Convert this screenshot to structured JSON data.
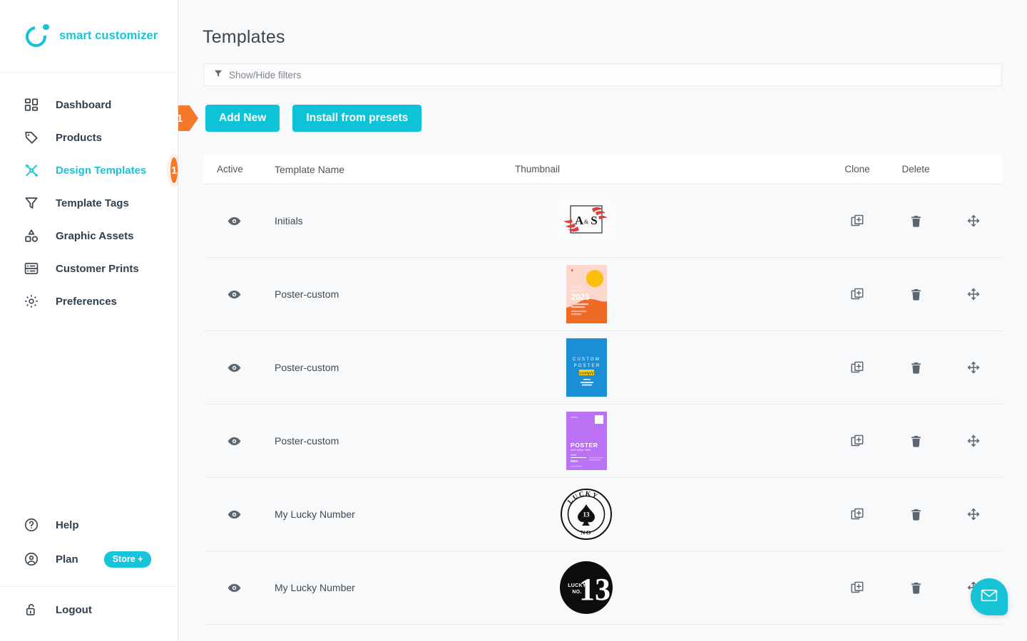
{
  "brand": {
    "name": "smart customizer",
    "logo_icon": "circle-dot-logo-icon",
    "color": "#18c4d9"
  },
  "sidebar": {
    "items": [
      {
        "label": "Dashboard",
        "icon": "grid-dashboard-icon",
        "active": false,
        "badge": null
      },
      {
        "label": "Products",
        "icon": "tag-icon",
        "active": false,
        "badge": null
      },
      {
        "label": "Design Templates",
        "icon": "scissors-icon",
        "active": true,
        "badge": "1"
      },
      {
        "label": "Template Tags",
        "icon": "funnel-filter-icon",
        "active": false,
        "badge": null
      },
      {
        "label": "Graphic Assets",
        "icon": "shapes-icon",
        "active": false,
        "badge": null
      },
      {
        "label": "Customer Prints",
        "icon": "print-rows-icon",
        "active": false,
        "badge": null
      },
      {
        "label": "Preferences",
        "icon": "gear-icon",
        "active": false,
        "badge": null
      }
    ],
    "help": {
      "label": "Help",
      "icon": "question-circle-icon"
    },
    "plan": {
      "label": "Plan",
      "icon": "user-circle-icon",
      "pill": "Store +"
    },
    "logout": {
      "label": "Logout",
      "icon": "unlock-padlock-icon"
    }
  },
  "main": {
    "title": "Templates",
    "filter_bar": {
      "label": "Show/Hide filters",
      "icon": "funnel-filter-icon"
    },
    "buttons": {
      "add_new": "Add New",
      "install_presets": "Install from presets",
      "step_badge": "1"
    },
    "table": {
      "headers": {
        "active": "Active",
        "name": "Template Name",
        "thumbnail": "Thumbnail",
        "clone": "Clone",
        "delete": "Delete"
      },
      "rows": [
        {
          "name": "Initials",
          "thumb": "initials-monogram",
          "visible_icon": "eye-icon",
          "clone_icon": "clone-icon",
          "delete_icon": "trash-icon",
          "move_icon": "move-arrows-icon"
        },
        {
          "name": "Poster-custom",
          "thumb": "poster-pink-2023",
          "visible_icon": "eye-icon",
          "clone_icon": "clone-icon",
          "delete_icon": "trash-icon",
          "move_icon": "move-arrows-icon"
        },
        {
          "name": "Poster-custom",
          "thumb": "poster-blue-custom",
          "visible_icon": "eye-icon",
          "clone_icon": "clone-icon",
          "delete_icon": "trash-icon",
          "move_icon": "move-arrows-icon"
        },
        {
          "name": "Poster-custom",
          "thumb": "poster-purple",
          "visible_icon": "eye-icon",
          "clone_icon": "clone-icon",
          "delete_icon": "trash-icon",
          "move_icon": "move-arrows-icon"
        },
        {
          "name": "My Lucky Number",
          "thumb": "lucky-badge-outline",
          "visible_icon": "eye-icon",
          "clone_icon": "clone-icon",
          "delete_icon": "trash-icon",
          "move_icon": "move-arrows-icon"
        },
        {
          "name": "My Lucky Number",
          "thumb": "lucky-badge-solid",
          "visible_icon": "eye-icon",
          "clone_icon": "clone-icon",
          "delete_icon": "trash-icon",
          "move_icon": "move-arrows-icon"
        }
      ]
    },
    "thumb_text": {
      "initials_left": "A",
      "initials_amp": "&",
      "initials_right": "S",
      "poster_pink_year": "2023",
      "poster_pink_label": "EVENT POSTER",
      "poster_blue_line1": "CUSTOM",
      "poster_blue_line2": "POSTER",
      "poster_blue_script": "example",
      "poster_purple_title": "POSTER",
      "lucky_top": "LUCKY",
      "lucky_bottom": "NO",
      "lucky_number": "13",
      "lucky_solid_small1": "LUCKY",
      "lucky_solid_small2": "NO.",
      "lucky_solid_number": "13"
    },
    "chat_fab": {
      "icon": "envelope-icon"
    }
  },
  "colors": {
    "accent": "#18c4d9",
    "badge": "#f4792b",
    "text": "#3b4651"
  }
}
